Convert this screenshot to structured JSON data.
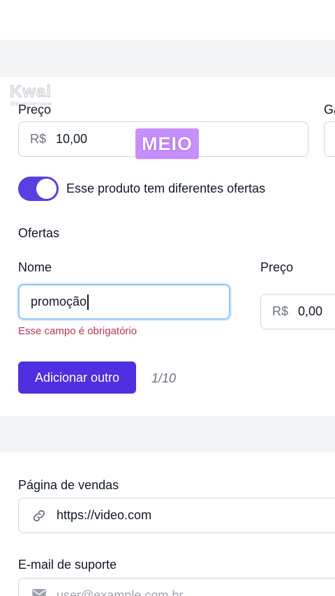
{
  "watermark": {
    "logo": "Kwai",
    "handle": "@kwaiusername"
  },
  "price_section": {
    "price_label": "Preço",
    "currency_prefix": "R$",
    "price_value": "10,00",
    "cut_label": "Ga",
    "overlay_text": "MEIO"
  },
  "toggle": {
    "label": "Esse produto tem diferentes ofertas",
    "on": true
  },
  "offers": {
    "heading": "Ofertas",
    "name_label": "Nome",
    "price_label": "Preço",
    "name_value": "promoção",
    "currency_prefix": "R$",
    "price_value": "0,00",
    "error": "Esse campo é obrigatório",
    "add_button": "Adicionar outro",
    "counter": "1/10"
  },
  "sales_page": {
    "label": "Página de vendas",
    "value": "https://video.com"
  },
  "support_email": {
    "label": "E-mail de suporte",
    "placeholder": "user@example.com.br"
  },
  "colors": {
    "accent": "#4f2fe0",
    "toggle": "#5b3ee0",
    "error": "#b4345a",
    "overlay": "#c084fc"
  }
}
